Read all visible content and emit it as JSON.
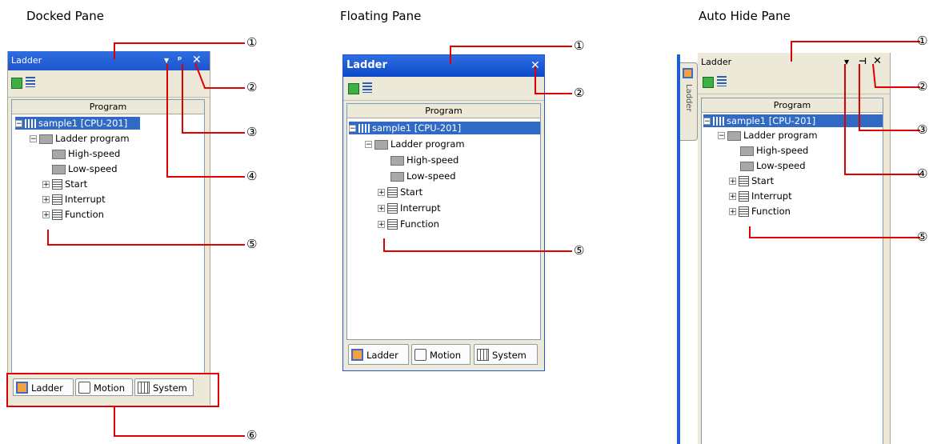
{
  "sections": {
    "docked": "Docked Pane",
    "floating": "Floating Pane",
    "autohide": "Auto Hide Pane"
  },
  "pane": {
    "title": "Ladder",
    "column_header": "Program",
    "tree": {
      "root": "sample1 [CPU-201]",
      "ladder_program": "Ladder program",
      "high_speed": "High-speed",
      "low_speed": "Low-speed",
      "start": "Start",
      "interrupt": "Interrupt",
      "function": "Function"
    },
    "tabs": {
      "ladder": "Ladder",
      "motion": "Motion",
      "system": "System"
    },
    "side_tab": "Ladder"
  },
  "callouts": {
    "c1": "①",
    "c2": "②",
    "c3": "③",
    "c4": "④",
    "c5": "⑤",
    "c6": "⑥"
  },
  "colors": {
    "callout_line": "#e00000",
    "selection": "#316ac5",
    "floating_title": "#0054e3",
    "docked_title": "#1f5fd6"
  }
}
